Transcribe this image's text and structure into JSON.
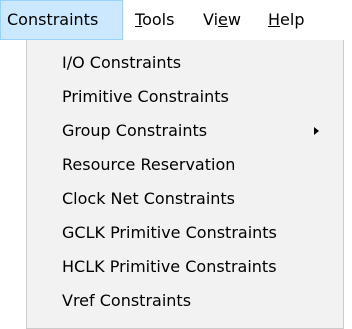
{
  "menubar": {
    "items": [
      {
        "pre": "Constraints",
        "mnemonic": "",
        "post": ""
      },
      {
        "pre": "",
        "mnemonic": "T",
        "post": "ools"
      },
      {
        "pre": "Vi",
        "mnemonic": "e",
        "post": "w"
      },
      {
        "pre": "",
        "mnemonic": "H",
        "post": "elp"
      }
    ]
  },
  "dropdown": {
    "items": [
      {
        "label": "I/O Constraints"
      },
      {
        "label": "Primitive Constraints"
      },
      {
        "label": "Group Constraints",
        "icon": "chevron-right-icon"
      },
      {
        "label": "Resource Reservation"
      },
      {
        "label": "Clock Net Constraints"
      },
      {
        "label": "GCLK Primitive Constraints"
      },
      {
        "label": "HCLK Primitive Constraints"
      },
      {
        "label": "Vref Constraints"
      }
    ]
  }
}
